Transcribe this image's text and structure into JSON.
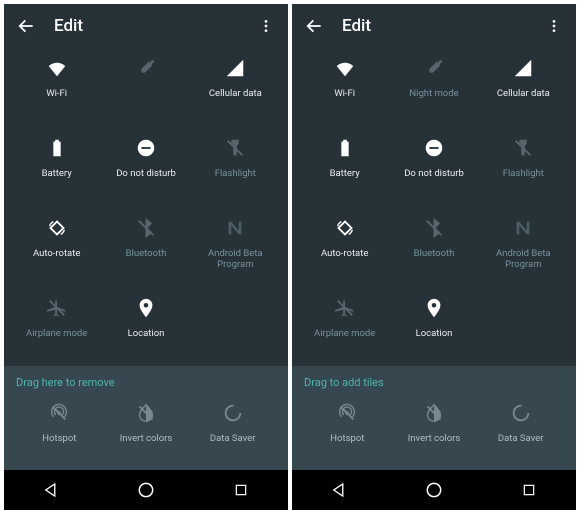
{
  "screens": [
    {
      "header": {
        "title": "Edit"
      },
      "tiles": [
        {
          "id": "wifi",
          "label": "Wi-Fi",
          "icon": "wifi",
          "dim": false
        },
        {
          "id": "tile2a",
          "label": "",
          "icon": "eyedropper",
          "dim": true
        },
        {
          "id": "cellular",
          "label": "Cellular data",
          "icon": "signal",
          "dim": false
        },
        {
          "id": "battery",
          "label": "Battery",
          "icon": "battery",
          "dim": false
        },
        {
          "id": "dnd",
          "label": "Do not disturb",
          "icon": "dnd",
          "dim": false
        },
        {
          "id": "flashlight",
          "label": "Flashlight",
          "icon": "flashlight",
          "dim": true
        },
        {
          "id": "autorotate",
          "label": "Auto-rotate",
          "icon": "rotate",
          "dim": false
        },
        {
          "id": "bluetooth",
          "label": "Bluetooth",
          "icon": "bluetooth",
          "dim": true
        },
        {
          "id": "beta",
          "label": "Android Beta Program",
          "icon": "nlogo",
          "dim": true
        },
        {
          "id": "airplane",
          "label": "Airplane mode",
          "icon": "airplane",
          "dim": true
        },
        {
          "id": "location",
          "label": "Location",
          "icon": "location",
          "dim": false
        }
      ],
      "dragLabel": "Drag here to remove",
      "dragTiles": [
        {
          "id": "hotspot",
          "label": "Hotspot",
          "icon": "hotspot"
        },
        {
          "id": "invert",
          "label": "Invert colors",
          "icon": "invert"
        },
        {
          "id": "datasaver",
          "label": "Data Saver",
          "icon": "datasaver"
        }
      ]
    },
    {
      "header": {
        "title": "Edit"
      },
      "tiles": [
        {
          "id": "wifi",
          "label": "Wi-Fi",
          "icon": "wifi",
          "dim": false
        },
        {
          "id": "nightmode",
          "label": "Night mode",
          "icon": "eyedropper",
          "dim": true
        },
        {
          "id": "cellular",
          "label": "Cellular data",
          "icon": "signal",
          "dim": false
        },
        {
          "id": "battery",
          "label": "Battery",
          "icon": "battery",
          "dim": false
        },
        {
          "id": "dnd",
          "label": "Do not disturb",
          "icon": "dnd",
          "dim": false
        },
        {
          "id": "flashlight",
          "label": "Flashlight",
          "icon": "flashlight",
          "dim": true
        },
        {
          "id": "autorotate",
          "label": "Auto-rotate",
          "icon": "rotate",
          "dim": false
        },
        {
          "id": "bluetooth",
          "label": "Bluetooth",
          "icon": "bluetooth",
          "dim": true
        },
        {
          "id": "beta",
          "label": "Android Beta Program",
          "icon": "nlogo",
          "dim": true
        },
        {
          "id": "airplane",
          "label": "Airplane mode",
          "icon": "airplane",
          "dim": true
        },
        {
          "id": "location",
          "label": "Location",
          "icon": "location",
          "dim": false
        }
      ],
      "dragLabel": "Drag to add tiles",
      "dragTiles": [
        {
          "id": "hotspot",
          "label": "Hotspot",
          "icon": "hotspot"
        },
        {
          "id": "invert",
          "label": "Invert colors",
          "icon": "invert"
        },
        {
          "id": "datasaver",
          "label": "Data Saver",
          "icon": "datasaver"
        }
      ]
    }
  ]
}
